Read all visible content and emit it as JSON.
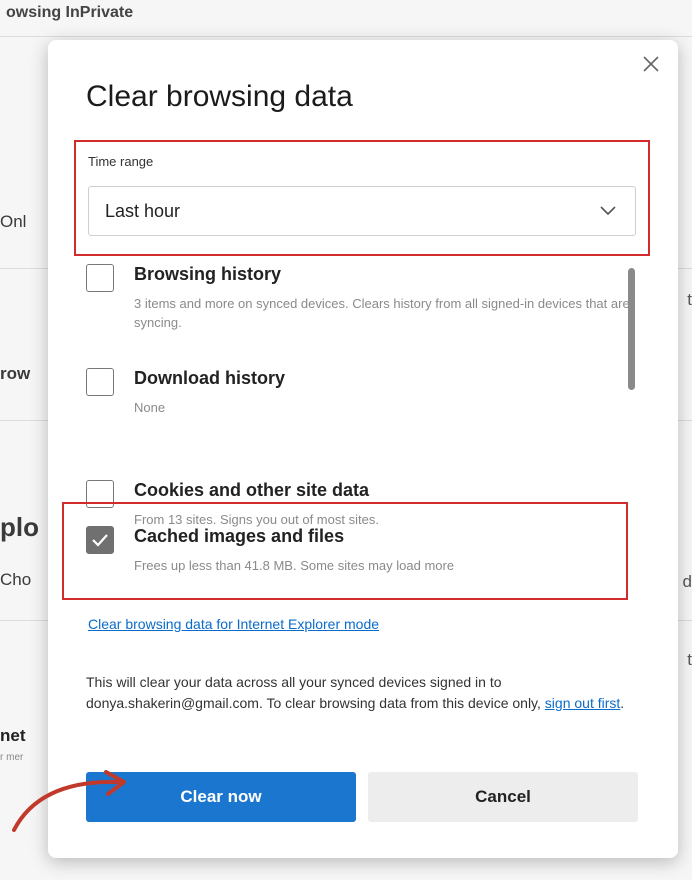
{
  "background": {
    "top_text": "owsing InPrivate",
    "row1": "Onl",
    "row2": "row",
    "heading": "plo",
    "row3": "Cho",
    "row4": "net",
    "row4_sub": "r mer",
    "right1": "t",
    "right2": "d",
    "right3": "t"
  },
  "dialog": {
    "title": "Clear browsing data",
    "close_icon": "close-icon",
    "time_range": {
      "label": "Time range",
      "selected": "Last hour"
    },
    "items": [
      {
        "title": "Browsing history",
        "desc": "3 items and more on synced devices. Clears history from all signed-in devices that are syncing.",
        "checked": false
      },
      {
        "title": "Download history",
        "desc": "None",
        "checked": false
      },
      {
        "title": "Cookies and other site data",
        "desc": "From 13 sites. Signs you out of most sites.",
        "checked": false
      },
      {
        "title": "Cached images and files",
        "desc": "Frees up less than 41.8 MB. Some sites may load more",
        "checked": true
      }
    ],
    "ie_link": "Clear browsing data for Internet Explorer mode",
    "note_before": "This will clear your data across all your synced devices signed in to donya.shakerin@gmail.com. To clear browsing data from this device only,",
    "note_link": "sign out first",
    "note_after": ".",
    "clear_button": "Clear now",
    "cancel_button": "Cancel"
  },
  "colors": {
    "accent": "#1b76cf",
    "highlight": "#d22b2b",
    "link": "#0b6bcb"
  }
}
